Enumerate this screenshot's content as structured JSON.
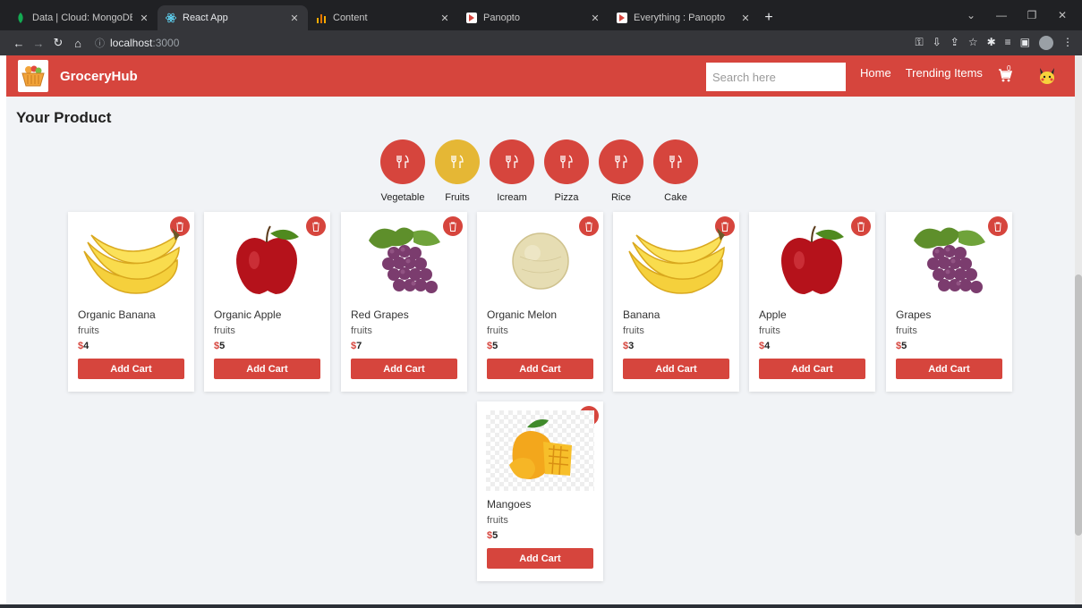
{
  "browser": {
    "tabs": [
      {
        "title": "Data | Cloud: MongoDB Cloud",
        "icon": "leaf-icon",
        "active": false
      },
      {
        "title": "React App",
        "icon": "react-icon",
        "active": true
      },
      {
        "title": "Content",
        "icon": "bar-chart-icon",
        "active": false
      },
      {
        "title": "Panopto",
        "icon": "panopto-icon",
        "active": false
      },
      {
        "title": "Everything : Panopto",
        "icon": "panopto-icon",
        "active": false
      }
    ],
    "url_host": "localhost",
    "url_port": ":3000"
  },
  "header": {
    "brand": "GroceryHub",
    "search_placeholder": "Search here",
    "nav": {
      "home": "Home",
      "trending": "Trending Items"
    },
    "cart_count": "0",
    "colors": {
      "primary": "#d6453d",
      "accent": "#e5b735"
    }
  },
  "main": {
    "title": "Your Product",
    "categories": [
      {
        "label": "Vegetable",
        "active": false
      },
      {
        "label": "Fruits",
        "active": true
      },
      {
        "label": "Icream",
        "active": false
      },
      {
        "label": "Pizza",
        "active": false
      },
      {
        "label": "Rice",
        "active": false
      },
      {
        "label": "Cake",
        "active": false
      }
    ],
    "products": [
      {
        "name": "Organic Banana",
        "category": "fruits",
        "currency": "$",
        "price": "4",
        "button": "Add Cart",
        "image": "banana"
      },
      {
        "name": "Organic Apple",
        "category": "fruits",
        "currency": "$",
        "price": "5",
        "button": "Add Cart",
        "image": "apple"
      },
      {
        "name": "Red Grapes",
        "category": "fruits",
        "currency": "$",
        "price": "7",
        "button": "Add Cart",
        "image": "grapes"
      },
      {
        "name": "Organic Melon",
        "category": "fruits",
        "currency": "$",
        "price": "5",
        "button": "Add Cart",
        "image": "melon"
      },
      {
        "name": "Banana",
        "category": "fruits",
        "currency": "$",
        "price": "3",
        "button": "Add Cart",
        "image": "banana"
      },
      {
        "name": "Apple",
        "category": "fruits",
        "currency": "$",
        "price": "4",
        "button": "Add Cart",
        "image": "apple"
      },
      {
        "name": "Grapes",
        "category": "fruits",
        "currency": "$",
        "price": "5",
        "button": "Add Cart",
        "image": "grapes"
      },
      {
        "name": "Mangoes",
        "category": "fruits",
        "currency": "$",
        "price": "5",
        "button": "Add Cart",
        "image": "mango"
      }
    ]
  }
}
